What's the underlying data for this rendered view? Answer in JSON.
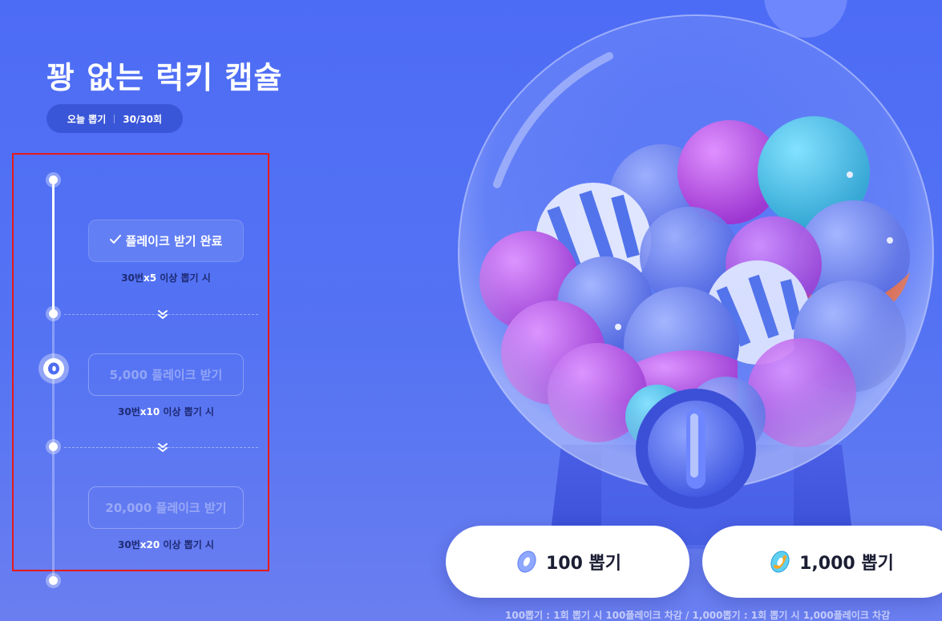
{
  "page": {
    "title": "꽝 없는 럭키 캡슐",
    "today": {
      "label": "오늘 뽑기",
      "value": "30/30회"
    }
  },
  "milestones": [
    {
      "reward_label": "플레이크 받기 완료",
      "status": "completed",
      "condition_prefix": "30번",
      "multiplier": "x5",
      "condition_suffix": " 이상 뽑기 시"
    },
    {
      "reward_label": "5,000 플레이크 받기",
      "status": "locked",
      "condition_prefix": "30번",
      "multiplier": "x10",
      "condition_suffix": " 이상 뽑기 시"
    },
    {
      "reward_label": "20,000 플레이크 받기",
      "status": "locked",
      "condition_prefix": "30번",
      "multiplier": "x20",
      "condition_suffix": " 이상 뽑기 시"
    }
  ],
  "icons": {
    "completed": "check-icon",
    "next_step": "double-chevron-down-icon",
    "current": "flake-coin-icon"
  },
  "draw_buttons": [
    {
      "label": "100 뽑기",
      "icon": "flake-coin-icon"
    },
    {
      "label": "1,000 뽑기",
      "icon": "flake-coin-gold-icon"
    }
  ],
  "footnote": "100뽑기 : 1회 뽑기 시 100플레이크 차감 / 1,000뽑기 : 1회 뽑기 시 1,000플레이크 차감",
  "colors": {
    "background": "#4d6cf5",
    "pill": "#3a56d8",
    "highlight_border": "#e81a1a",
    "condition_text": "#1e2a73",
    "capsule_magenta": "#c23fe0",
    "capsule_cyan": "#2ad0e0",
    "capsule_orange": "#f05a1e"
  }
}
